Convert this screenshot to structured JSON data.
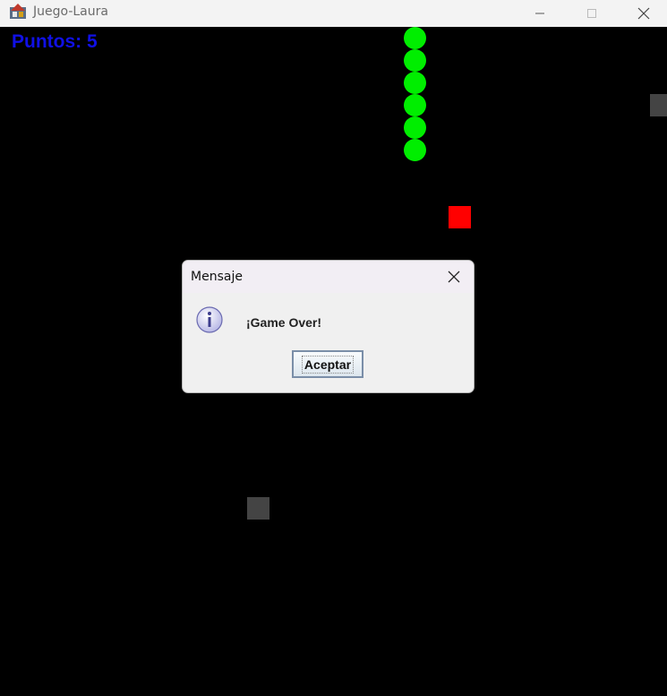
{
  "window": {
    "title": "Juego-Laura",
    "controls": {
      "minimize_icon": "minimize-icon",
      "maximize_icon": "maximize-icon",
      "close_icon": "close-icon"
    }
  },
  "game": {
    "score_text": "Puntos: 5",
    "colors": {
      "background": "#000000",
      "snake": "#00ee00",
      "food": "#ff0000",
      "obstacle": "#444444",
      "score": "#1010e6"
    },
    "snake_length": 6,
    "obstacle_count": 2
  },
  "dialog": {
    "title": "Mensaje",
    "message": "¡Game Over!",
    "button_label": "Aceptar",
    "icon": "info-icon",
    "close_icon": "close-icon"
  }
}
